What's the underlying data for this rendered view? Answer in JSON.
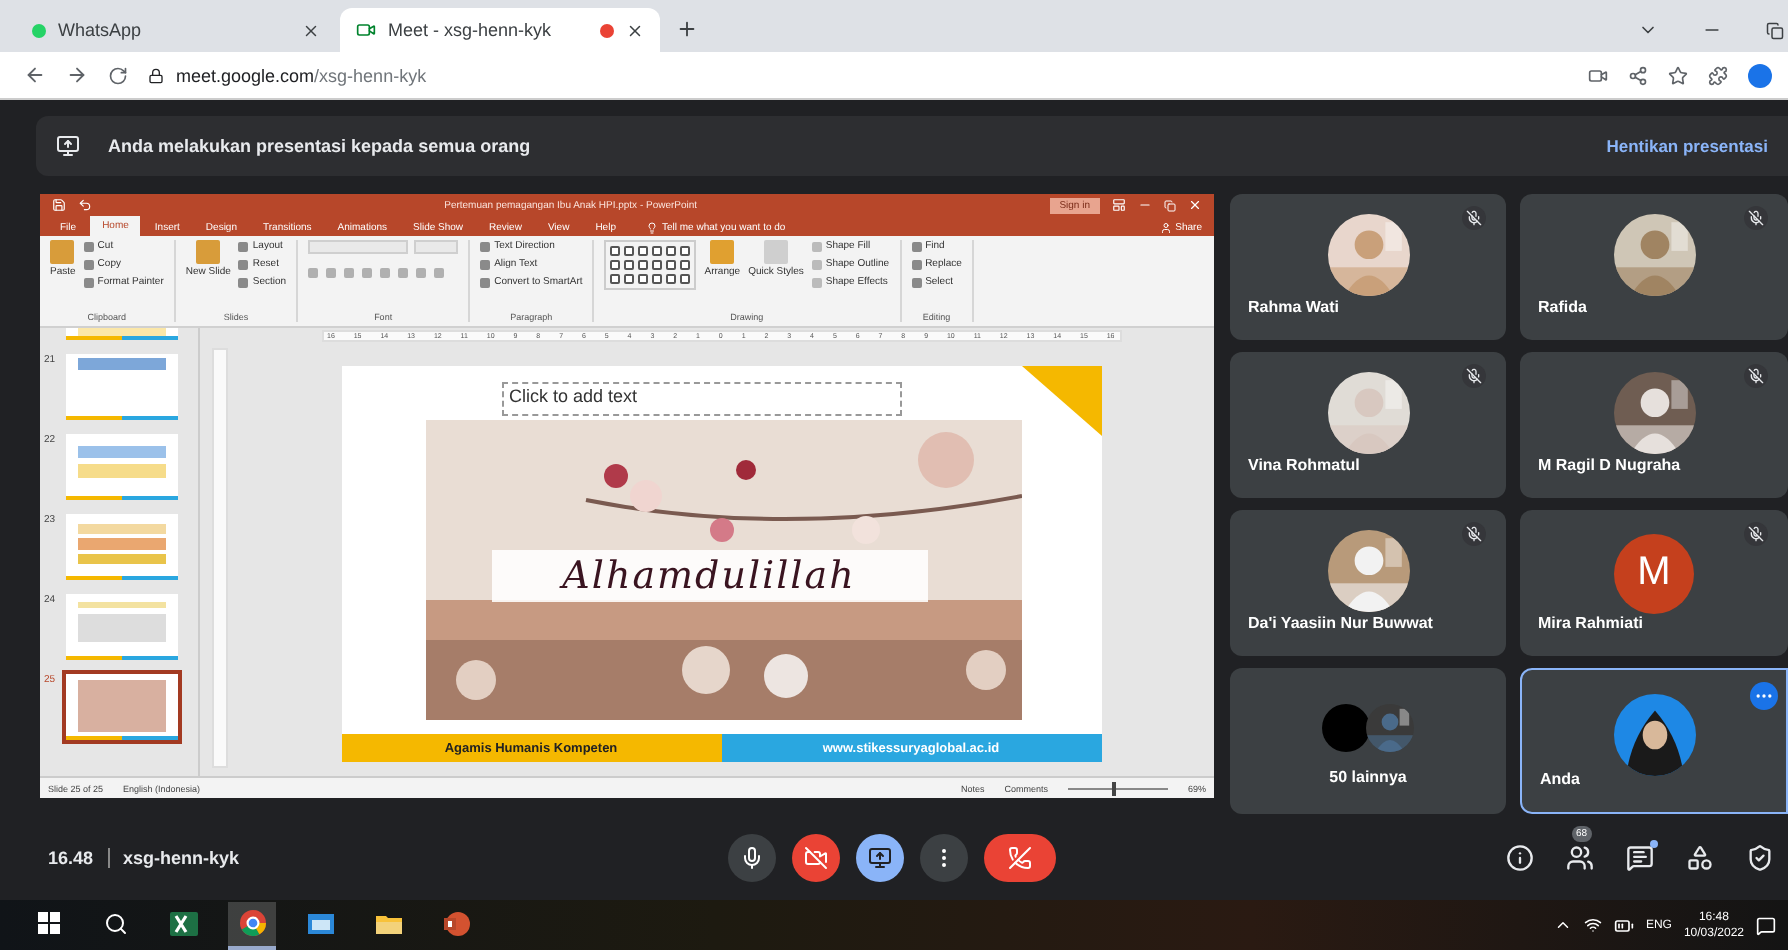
{
  "browser": {
    "tabs": [
      {
        "title": "WhatsApp",
        "kind": "whatsapp",
        "selected": false,
        "recording": false
      },
      {
        "title": "Meet - xsg-henn-kyk",
        "kind": "meet",
        "selected": true,
        "recording": true
      }
    ],
    "url_host": "meet.google.com",
    "url_path": "/xsg-henn-kyk"
  },
  "banner": {
    "message": "Anda melakukan presentasi kepada semua orang",
    "action": "Hentikan presentasi"
  },
  "powerpoint": {
    "title": "Pertemuan pemagangan Ibu Anak HPI.pptx - PowerPoint",
    "sign_in": "Sign in",
    "share": "Share",
    "tell_me": "Tell me what you want to do",
    "menu_tabs": [
      {
        "label": "File",
        "selected": false
      },
      {
        "label": "Home",
        "selected": true
      },
      {
        "label": "Insert",
        "selected": false
      },
      {
        "label": "Design",
        "selected": false
      },
      {
        "label": "Transitions",
        "selected": false
      },
      {
        "label": "Animations",
        "selected": false
      },
      {
        "label": "Slide Show",
        "selected": false
      },
      {
        "label": "Review",
        "selected": false
      },
      {
        "label": "View",
        "selected": false
      },
      {
        "label": "Help",
        "selected": false
      }
    ],
    "ribbon_groups": [
      {
        "label": "Clipboard",
        "kind": "items",
        "big": "Paste",
        "items": [
          "Cut",
          "Copy",
          "Format Painter"
        ]
      },
      {
        "label": "Slides",
        "kind": "items",
        "big": "New Slide",
        "items": [
          "Layout",
          "Reset",
          "Section"
        ]
      },
      {
        "label": "Font",
        "kind": "font"
      },
      {
        "label": "Paragraph",
        "kind": "items",
        "items": [
          "Text Direction",
          "Align Text",
          "Convert to SmartArt"
        ]
      },
      {
        "label": "Drawing",
        "kind": "drawing",
        "big": "Arrange",
        "second": "Quick Styles",
        "items": [
          "Shape Fill",
          "Shape Outline",
          "Shape Effects"
        ]
      },
      {
        "label": "Editing",
        "kind": "items",
        "items": [
          "Find",
          "Replace",
          "Select"
        ]
      }
    ],
    "ruler": [
      "16",
      "15",
      "14",
      "13",
      "12",
      "11",
      "10",
      "9",
      "8",
      "7",
      "6",
      "5",
      "4",
      "3",
      "2",
      "1",
      "0",
      "1",
      "2",
      "3",
      "4",
      "5",
      "6",
      "7",
      "8",
      "9",
      "10",
      "11",
      "12",
      "13",
      "14",
      "15",
      "16"
    ],
    "thumbnails": [
      {
        "selected": false
      },
      {
        "number": "21",
        "selected": false
      },
      {
        "number": "22",
        "selected": false
      },
      {
        "number": "23",
        "selected": false
      },
      {
        "number": "24",
        "selected": false
      },
      {
        "number": "25",
        "selected": true
      }
    ],
    "slide": {
      "placeholder": "Click to add text",
      "caption": "Alhamdulillah",
      "footer_left": "Agamis Humanis Kompeten",
      "footer_right": "www.stikessuryaglobal.ac.id"
    },
    "status": {
      "slide_info": "Slide 25 of 25",
      "language": "English (Indonesia)",
      "notes": "Notes",
      "comments": "Comments",
      "zoom": "69%",
      "zoom_slider": {
        "level": 0.45
      }
    }
  },
  "participants": [
    {
      "name": "Rahma Wati",
      "muted": true,
      "highlighted": false
    },
    {
      "name": "Rafida",
      "muted": true,
      "highlighted": false
    },
    {
      "name": "Vina Rohmatul",
      "muted": true,
      "highlighted": false
    },
    {
      "name": "M Ragil D Nugraha",
      "muted": true,
      "highlighted": false
    },
    {
      "name": "Da'i Yaasiin Nur Buwwat",
      "muted": true,
      "highlighted": false
    },
    {
      "name": "Mira Rahmiati",
      "kind": "letter",
      "letter": "M",
      "muted": true,
      "highlighted": false
    },
    {
      "name": "50 lainnya",
      "kind": "group",
      "highlighted": false
    },
    {
      "name": "Anda",
      "kind": "self",
      "muted": false,
      "highlighted": true
    }
  ],
  "call_bar": {
    "time": "16.48",
    "meeting_code": "xsg-henn-kyk",
    "controls": [
      {
        "kind": "mic",
        "on": true
      },
      {
        "kind": "camera",
        "on": false
      },
      {
        "kind": "present",
        "on": true
      },
      {
        "kind": "more"
      },
      {
        "kind": "hangup"
      }
    ],
    "tools": [
      {
        "kind": "info"
      },
      {
        "kind": "people",
        "badge": "68"
      },
      {
        "kind": "chat",
        "dot": true
      },
      {
        "kind": "activities"
      },
      {
        "kind": "host"
      }
    ]
  },
  "taskbar": {
    "apps": [
      {
        "kind": "start",
        "selected": false
      },
      {
        "kind": "search",
        "selected": false
      },
      {
        "kind": "excel",
        "selected": false
      },
      {
        "kind": "chrome",
        "selected": true
      },
      {
        "kind": "window",
        "selected": false
      },
      {
        "kind": "folder",
        "selected": false
      },
      {
        "kind": "powerpoint",
        "selected": false
      }
    ],
    "language": "ENG",
    "time": "16:48",
    "date": "10/03/2022"
  }
}
